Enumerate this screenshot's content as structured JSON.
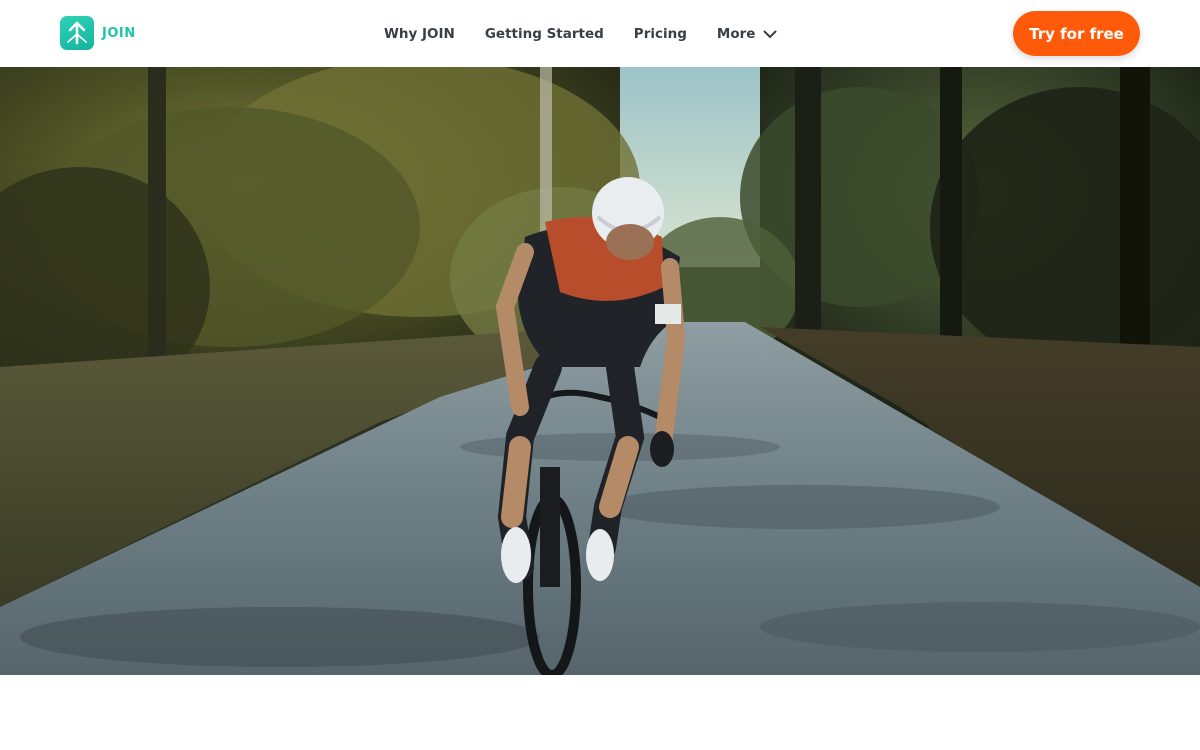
{
  "header": {
    "logo_text": "JOIN",
    "nav": [
      {
        "label": "Why JOIN"
      },
      {
        "label": "Getting Started"
      },
      {
        "label": "Pricing"
      },
      {
        "label": "More"
      }
    ],
    "cta_label": "Try for free"
  },
  "colors": {
    "brand": "#1fc3ab",
    "cta": "#ff5a0a",
    "nav_text": "#3a3f45"
  },
  "icons": {
    "logo": "join-logo-icon",
    "more": "chevron-down-icon"
  }
}
